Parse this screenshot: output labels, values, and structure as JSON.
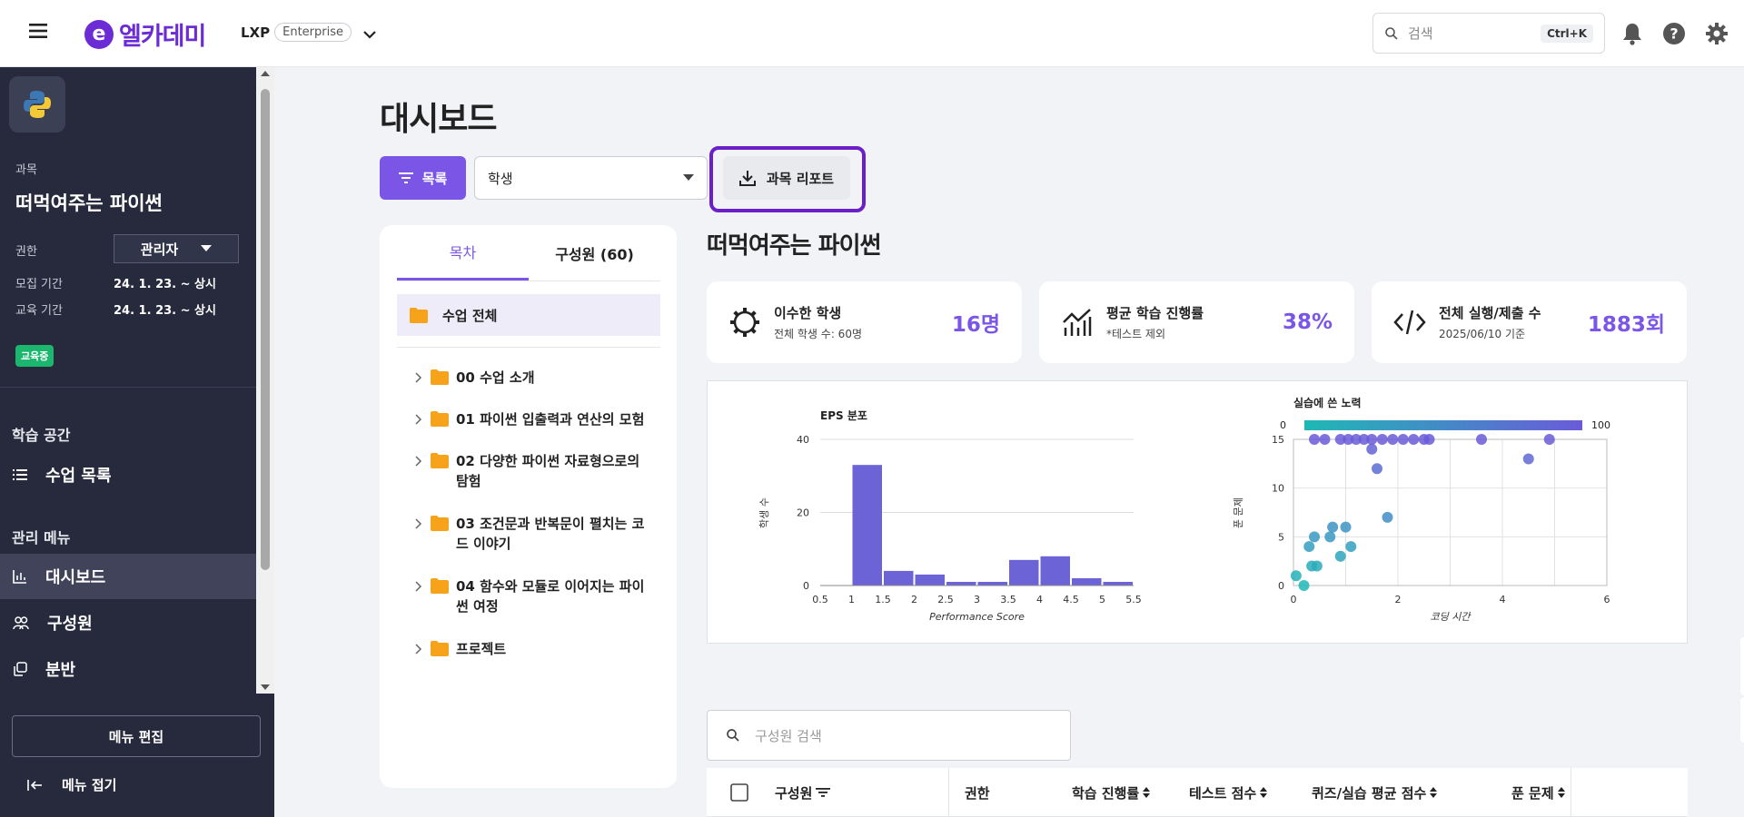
{
  "brand": {
    "logo_text": "엘카데미",
    "logo_letter": "e",
    "product": "LXP",
    "edition": "Enterprise"
  },
  "search": {
    "placeholder": "검색",
    "shortcut": "Ctrl+K"
  },
  "sidebar": {
    "course_label": "과목",
    "course_title": "떠먹여주는 파이썬",
    "role_label": "권한",
    "role_value": "관리자",
    "recruit_label": "모집 기간",
    "recruit_value": "24. 1. 23. ~ 상시",
    "edu_label": "교육 기간",
    "edu_value": "24. 1. 23. ~ 상시",
    "status_badge": "교육중",
    "section_learning": "학습 공간",
    "item_lessons": "수업 목록",
    "section_admin": "관리 메뉴",
    "item_dashboard": "대시보드",
    "item_members": "구성원",
    "item_classes": "분반",
    "menu_edit": "메뉴 편집",
    "collapse": "메뉴 접기"
  },
  "page": {
    "title": "대시보드",
    "list_button": "목록",
    "select_value": "학생",
    "report_button": "과목 리포트",
    "course_title": "떠먹여주는 파이썬"
  },
  "toc": {
    "tab_toc": "목차",
    "tab_members": "구성원 (60)",
    "all_lessons": "수업 전체",
    "items": [
      "00 수업 소개",
      "01 파이썬 입출력과 연산의 모험",
      "02 다양한 파이썬 자료형으로의 탐험",
      "03 조건문과 반복문이 펼치는 코드 이야기",
      "04 함수와 모듈로 이어지는 파이썬 여정",
      "프로젝트"
    ]
  },
  "stats": [
    {
      "title": "이수한 학생",
      "sub": "전체 학생 수: 60명",
      "value": "16명",
      "icon": "gear-icon"
    },
    {
      "title": "평균 학습 진행률",
      "sub": "*테스트 제외",
      "value": "38%",
      "icon": "chart-line-icon"
    },
    {
      "title": "전체 실행/제출 수",
      "sub": "2025/06/10 기준",
      "value": "1883회",
      "icon": "code-icon"
    }
  ],
  "chart_data": [
    {
      "type": "bar",
      "title": "EPS 분포",
      "xlabel": "Performance Score",
      "ylabel": "학생 수",
      "bins": [
        [
          1,
          1.5
        ],
        [
          1.5,
          2
        ],
        [
          2,
          2.5
        ],
        [
          2.5,
          3
        ],
        [
          3,
          3.5
        ],
        [
          3.5,
          4
        ],
        [
          4,
          4.5
        ],
        [
          4.5,
          5
        ],
        [
          5,
          5.5
        ]
      ],
      "values": [
        33,
        4,
        3,
        1,
        1,
        7,
        8,
        2,
        1
      ],
      "xticks": [
        "0.5",
        "1",
        "1.5",
        "2",
        "2.5",
        "3",
        "3.5",
        "4",
        "4.5",
        "5",
        "5.5"
      ],
      "xlim": [
        0.5,
        5.5
      ],
      "yticks": [
        "0",
        "20",
        "40"
      ],
      "ylim": [
        0,
        40
      ],
      "color": "#6b63d6"
    },
    {
      "type": "scatter",
      "title": "실습에 쓴 노력",
      "xlabel": "코딩 시간",
      "ylabel": "푼 문제",
      "colorbar": {
        "min": "0",
        "max": "100",
        "colors": [
          "#1fb8b5",
          "#6a5bd8"
        ]
      },
      "xticks": [
        "0",
        "2",
        "4",
        "6"
      ],
      "xlim": [
        0,
        6
      ],
      "yticks": [
        "0",
        "5",
        "10",
        "15"
      ],
      "ylim": [
        0,
        15
      ],
      "points": [
        [
          0.05,
          1
        ],
        [
          0.2,
          0
        ],
        [
          0.3,
          4
        ],
        [
          0.35,
          2
        ],
        [
          0.4,
          5
        ],
        [
          0.45,
          2
        ],
        [
          0.7,
          5
        ],
        [
          0.75,
          6
        ],
        [
          0.9,
          3
        ],
        [
          1,
          6
        ],
        [
          1.1,
          4
        ],
        [
          1.8,
          7
        ],
        [
          1.6,
          12
        ],
        [
          1.5,
          14
        ],
        [
          0.4,
          15
        ],
        [
          0.6,
          15
        ],
        [
          0.9,
          15
        ],
        [
          1.05,
          15
        ],
        [
          1.2,
          15
        ],
        [
          1.35,
          15
        ],
        [
          1.5,
          15
        ],
        [
          1.7,
          15
        ],
        [
          1.9,
          15
        ],
        [
          2.1,
          15
        ],
        [
          2.3,
          15
        ],
        [
          2.5,
          15
        ],
        [
          2.6,
          15
        ],
        [
          3.6,
          15
        ],
        [
          4.5,
          13
        ],
        [
          4.9,
          15
        ]
      ]
    }
  ],
  "members": {
    "search_placeholder": "구성원 검색",
    "columns": [
      "구성원",
      "권한",
      "학습 진행률",
      "테스트 점수",
      "퀴즈/실습 평균 점수",
      "푼 문제"
    ]
  }
}
